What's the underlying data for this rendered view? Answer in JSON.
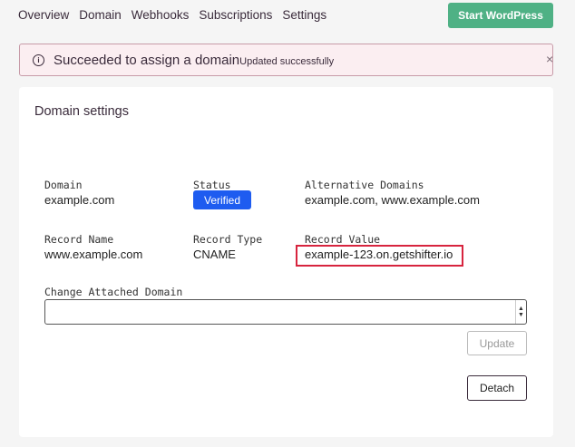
{
  "nav": {
    "items": [
      "Overview",
      "Domain",
      "Webhooks",
      "Subscriptions",
      "Settings"
    ],
    "start_button": "Start WordPress"
  },
  "alert": {
    "icon": "info-icon",
    "title": "Succeeded to assign a domain",
    "subtitle": "Updated successfully",
    "close": "×"
  },
  "card": {
    "title": "Domain settings",
    "domain_label": "Domain",
    "domain_value": "example.com",
    "status_label": "Status",
    "status_value": "Verified",
    "alt_label": "Alternative Domains",
    "alt_value": "example.com, www.example.com",
    "record_name_label": "Record Name",
    "record_name_value": "www.example.com",
    "record_type_label": "Record Type",
    "record_type_value": "CNAME",
    "record_value_label": "Record Value",
    "record_value_value": "example-123.on.getshifter.io",
    "change_label": "Change Attached Domain",
    "select_value": "",
    "update_button": "Update",
    "detach_button": "Detach"
  },
  "colors": {
    "start_button": "#4fb185",
    "alert_bg": "#fbeef1",
    "badge": "#1e5cf0",
    "highlight": "#d7243e"
  }
}
